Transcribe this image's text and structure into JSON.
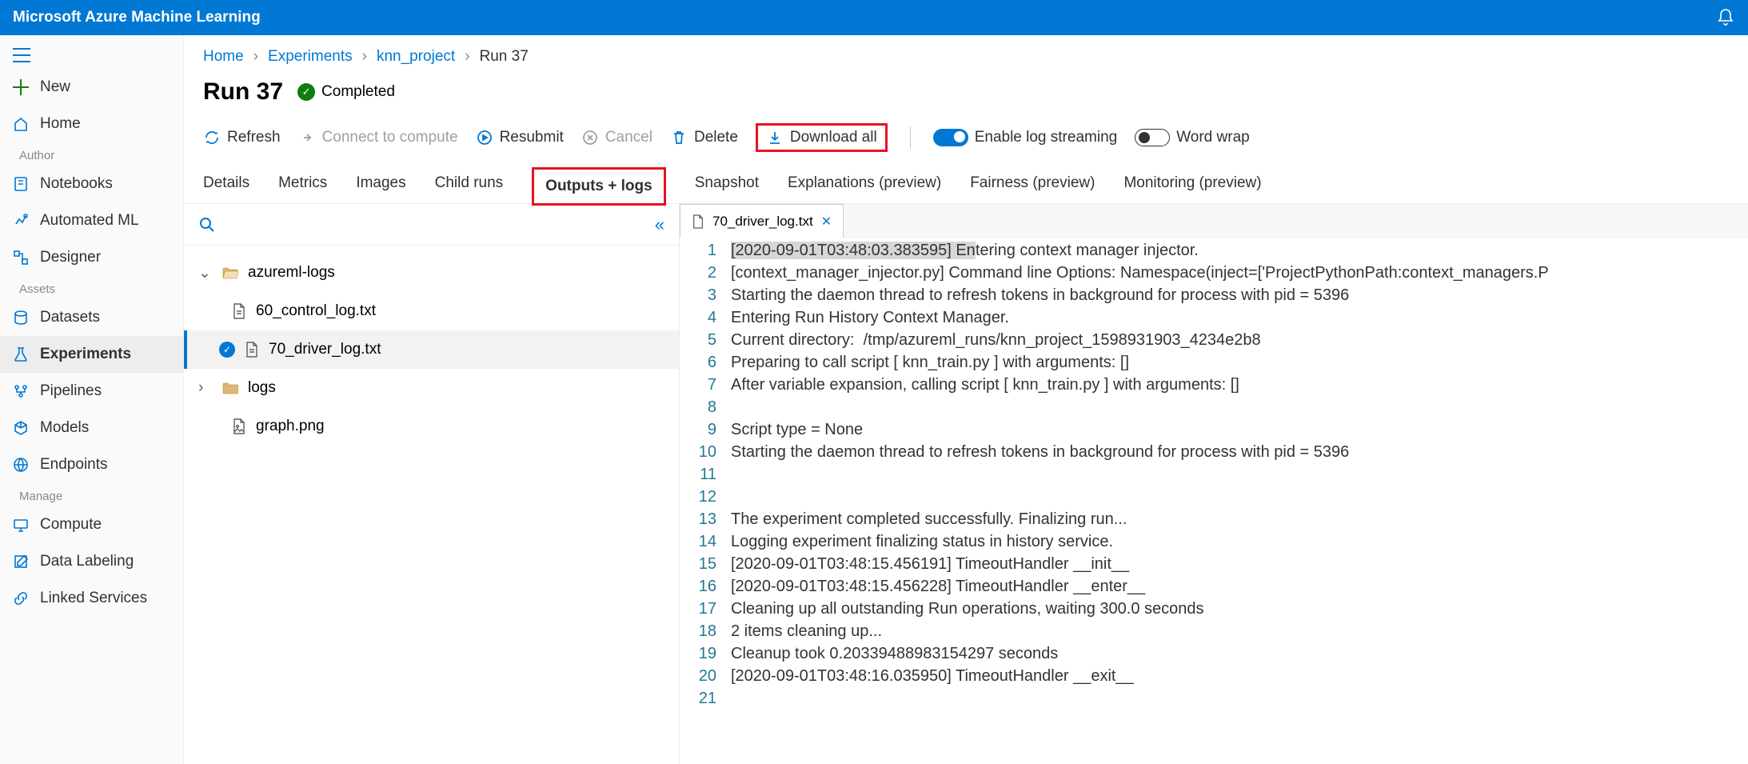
{
  "app_title": "Microsoft Azure Machine Learning",
  "breadcrumb": {
    "home": "Home",
    "experiments": "Experiments",
    "project": "knn_project",
    "run": "Run 37"
  },
  "page_title": "Run 37",
  "status": "Completed",
  "toolbar": {
    "refresh": "Refresh",
    "connect": "Connect to compute",
    "resubmit": "Resubmit",
    "cancel": "Cancel",
    "delete": "Delete",
    "download_all": "Download all",
    "log_stream": "Enable log streaming",
    "word_wrap": "Word wrap"
  },
  "tabs": {
    "details": "Details",
    "metrics": "Metrics",
    "images": "Images",
    "child_runs": "Child runs",
    "outputs_logs": "Outputs + logs",
    "snapshot": "Snapshot",
    "explanations": "Explanations (preview)",
    "fairness": "Fairness (preview)",
    "monitoring": "Monitoring (preview)"
  },
  "sidebar": {
    "new": "New",
    "home": "Home",
    "author": "Author",
    "notebooks": "Notebooks",
    "automl": "Automated ML",
    "designer": "Designer",
    "assets": "Assets",
    "datasets": "Datasets",
    "experiments": "Experiments",
    "pipelines": "Pipelines",
    "models": "Models",
    "endpoints": "Endpoints",
    "manage": "Manage",
    "compute": "Compute",
    "data_labeling": "Data Labeling",
    "linked_services": "Linked Services"
  },
  "tree": {
    "folder1": "azureml-logs",
    "file1": "60_control_log.txt",
    "file2": "70_driver_log.txt",
    "folder2": "logs",
    "file3": "graph.png"
  },
  "open_file": "70_driver_log.txt",
  "log_lines": [
    "[2020-09-01T03:48:03.383595] Entering context manager injector.",
    "[context_manager_injector.py] Command line Options: Namespace(inject=['ProjectPythonPath:context_managers.P",
    "Starting the daemon thread to refresh tokens in background for process with pid = 5396",
    "Entering Run History Context Manager.",
    "Current directory:  /tmp/azureml_runs/knn_project_1598931903_4234e2b8",
    "Preparing to call script [ knn_train.py ] with arguments: []",
    "After variable expansion, calling script [ knn_train.py ] with arguments: []",
    "",
    "Script type = None",
    "Starting the daemon thread to refresh tokens in background for process with pid = 5396",
    "",
    "",
    "The experiment completed successfully. Finalizing run...",
    "Logging experiment finalizing status in history service.",
    "[2020-09-01T03:48:15.456191] TimeoutHandler __init__",
    "[2020-09-01T03:48:15.456228] TimeoutHandler __enter__",
    "Cleaning up all outstanding Run operations, waiting 300.0 seconds",
    "2 items cleaning up...",
    "Cleanup took 0.20339488983154297 seconds",
    "[2020-09-01T03:48:16.035950] TimeoutHandler __exit__",
    ""
  ]
}
